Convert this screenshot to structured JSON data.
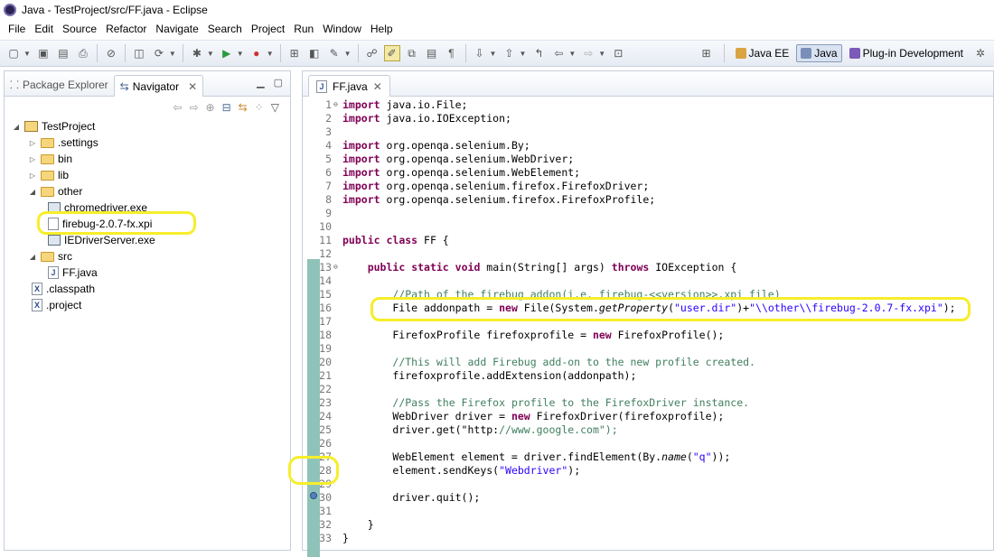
{
  "window": {
    "title": "Java - TestProject/src/FF.java - Eclipse"
  },
  "menu": [
    "File",
    "Edit",
    "Source",
    "Refactor",
    "Navigate",
    "Search",
    "Project",
    "Run",
    "Window",
    "Help"
  ],
  "perspectives": [
    {
      "label": "Java EE",
      "selected": false
    },
    {
      "label": "Java",
      "selected": true
    },
    {
      "label": "Plug-in Development",
      "selected": false
    }
  ],
  "left_panel": {
    "tabs": [
      {
        "label": "Package Explorer",
        "active": false
      },
      {
        "label": "Navigator",
        "active": true
      }
    ],
    "tree": [
      {
        "label": "TestProject",
        "kind": "project",
        "level": 0,
        "expanded": true
      },
      {
        "label": ".settings",
        "kind": "folder",
        "level": 1,
        "expanded": false
      },
      {
        "label": "bin",
        "kind": "folder",
        "level": 1,
        "expanded": false
      },
      {
        "label": "lib",
        "kind": "folder",
        "level": 1,
        "expanded": false
      },
      {
        "label": "other",
        "kind": "folder",
        "level": 1,
        "expanded": true
      },
      {
        "label": "chromedriver.exe",
        "kind": "exe",
        "level": 2
      },
      {
        "label": "firebug-2.0.7-fx.xpi",
        "kind": "file",
        "level": 2
      },
      {
        "label": "IEDriverServer.exe",
        "kind": "exe",
        "level": 2
      },
      {
        "label": "src",
        "kind": "folder",
        "level": 1,
        "expanded": true
      },
      {
        "label": "FF.java",
        "kind": "java",
        "level": 2
      },
      {
        "label": ".classpath",
        "kind": "xml",
        "level": 1
      },
      {
        "label": ".project",
        "kind": "xml",
        "level": 1
      }
    ]
  },
  "editor": {
    "tab_label": "FF.java",
    "lines": [
      {
        "n": "1",
        "t": "import java.io.File;",
        "fold": "minus"
      },
      {
        "n": "2",
        "t": "import java.io.IOException;"
      },
      {
        "n": "3",
        "t": ""
      },
      {
        "n": "4",
        "t": "import org.openqa.selenium.By;"
      },
      {
        "n": "5",
        "t": "import org.openqa.selenium.WebDriver;"
      },
      {
        "n": "6",
        "t": "import org.openqa.selenium.WebElement;"
      },
      {
        "n": "7",
        "t": "import org.openqa.selenium.firefox.FirefoxDriver;"
      },
      {
        "n": "8",
        "t": "import org.openqa.selenium.firefox.FirefoxProfile;"
      },
      {
        "n": "9",
        "t": ""
      },
      {
        "n": "10",
        "t": ""
      },
      {
        "n": "11",
        "t": "public class FF {"
      },
      {
        "n": "12",
        "t": ""
      },
      {
        "n": "13",
        "t": "    public static void main(String[] args) throws IOException {",
        "fold": "minus"
      },
      {
        "n": "14",
        "t": ""
      },
      {
        "n": "15",
        "t": "        //Path of the firebug addon(i.e. firebug-<<version>>.xpi file)"
      },
      {
        "n": "16",
        "t": "        File addonpath = new File(System.getProperty(\"user.dir\")+\"\\\\other\\\\firebug-2.0.7-fx.xpi\");"
      },
      {
        "n": "17",
        "t": ""
      },
      {
        "n": "18",
        "t": "        FirefoxProfile firefoxprofile = new FirefoxProfile();"
      },
      {
        "n": "19",
        "t": ""
      },
      {
        "n": "20",
        "t": "        //This will add Firebug add-on to the new profile created."
      },
      {
        "n": "21",
        "t": "        firefoxprofile.addExtension(addonpath);"
      },
      {
        "n": "22",
        "t": ""
      },
      {
        "n": "23",
        "t": "        //Pass the Firefox profile to the FirefoxDriver instance."
      },
      {
        "n": "24",
        "t": "        WebDriver driver = new FirefoxDriver(firefoxprofile);"
      },
      {
        "n": "25",
        "t": "        driver.get(\"http://www.google.com\");"
      },
      {
        "n": "26",
        "t": ""
      },
      {
        "n": "27",
        "t": "        WebElement element = driver.findElement(By.name(\"q\"));"
      },
      {
        "n": "28",
        "t": "        element.sendKeys(\"Webdriver\");"
      },
      {
        "n": "29",
        "t": ""
      },
      {
        "n": "30",
        "t": "        driver.quit();"
      },
      {
        "n": "31",
        "t": ""
      },
      {
        "n": "32",
        "t": "    }"
      },
      {
        "n": "33",
        "t": "}"
      }
    ]
  },
  "colors": {
    "keyword": "#7f0055",
    "string": "#2a00ff",
    "comment": "#3f7f5f",
    "highlight": "#f6ee2a"
  }
}
